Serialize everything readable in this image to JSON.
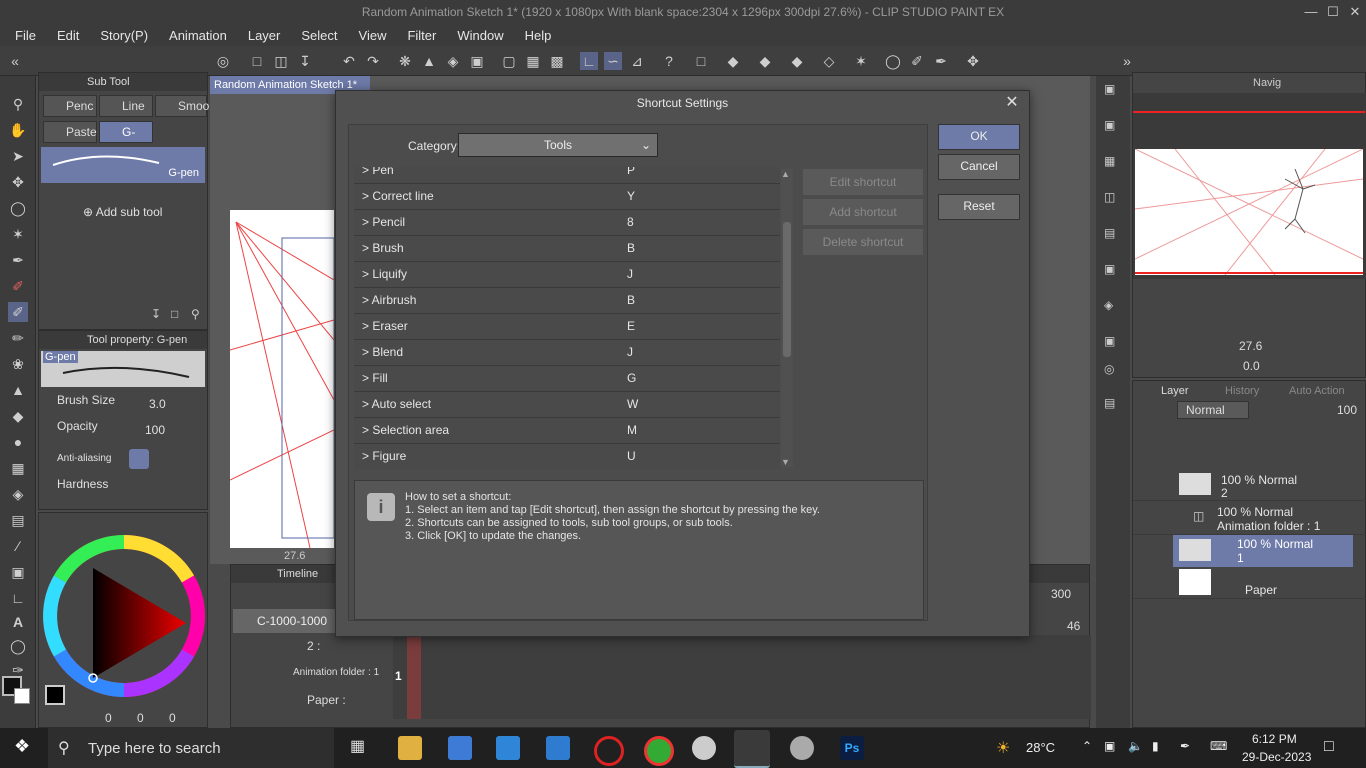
{
  "window": {
    "title": "Random Animation Sketch 1* (1920 x 1080px With blank space:2304 x 1296px 300dpi 27.6%) - CLIP STUDIO PAINT EX"
  },
  "menu": [
    "File",
    "Edit",
    "Story(P)",
    "Animation",
    "Layer",
    "Select",
    "View",
    "Filter",
    "Window",
    "Help"
  ],
  "subtool": {
    "header": "Sub Tool",
    "tabs": [
      "Penc",
      "Line",
      "Smoo",
      "Paste",
      "G-pen"
    ],
    "preview_label": "G-pen",
    "add": "Add sub tool"
  },
  "tool_property": {
    "header": "Tool property: G-pen",
    "preview_label": "G-pen",
    "brush_size_label": "Brush Size",
    "brush_size": "3.0",
    "opacity_label": "Opacity",
    "opacity": "100",
    "aa_label": "Anti-aliasing",
    "hardness_label": "Hardness"
  },
  "color": {
    "r": "0",
    "g": "0",
    "b": "0"
  },
  "canvas": {
    "tab": "Random Animation Sketch 1*",
    "zoom": "27.6"
  },
  "timeline": {
    "header": "Timeline",
    "track_name": "C-1000-1000",
    "frame_end": "300",
    "frame_mark": "46",
    "rows": [
      "2 :",
      "Animation folder : 1",
      "Paper :"
    ],
    "cell": "1"
  },
  "dialog": {
    "title": "Shortcut Settings",
    "category_label": "Category:",
    "category_value": "Tools",
    "items": [
      {
        "name": "> Pen",
        "key": "P"
      },
      {
        "name": "> Correct line",
        "key": "Y"
      },
      {
        "name": "> Pencil",
        "key": "8"
      },
      {
        "name": "> Brush",
        "key": "B"
      },
      {
        "name": "> Liquify",
        "key": "J"
      },
      {
        "name": "> Airbrush",
        "key": "B"
      },
      {
        "name": "> Eraser",
        "key": "E"
      },
      {
        "name": "> Blend",
        "key": "J"
      },
      {
        "name": "> Fill",
        "key": "G"
      },
      {
        "name": "> Auto select",
        "key": "W"
      },
      {
        "name": "> Selection area",
        "key": "M"
      },
      {
        "name": "> Figure",
        "key": "U"
      }
    ],
    "side_buttons": [
      "Edit shortcut",
      "Add shortcut",
      "Delete shortcut"
    ],
    "ok": "OK",
    "cancel": "Cancel",
    "reset": "Reset",
    "info": [
      "How to set a shortcut:",
      "1. Select an item and tap [Edit shortcut], then assign the shortcut by pressing the key.",
      "2. Shortcuts can be assigned to tools, sub tool groups, or sub tools.",
      "3. Click [OK] to update the changes."
    ]
  },
  "navigator": {
    "tab": "Navig",
    "zoom": "27.6",
    "rotation": "0.0"
  },
  "layers": {
    "tab": "Layer",
    "tab2": "History",
    "tab3": "Auto Action",
    "blend": "Normal",
    "opacity": "100",
    "items": [
      {
        "mode": "100 % Normal",
        "name": "2"
      },
      {
        "mode": "100 % Normal",
        "name": "Animation folder : 1"
      },
      {
        "mode": "100 % Normal",
        "name": "1"
      },
      {
        "mode": "",
        "name": "Paper"
      }
    ]
  },
  "taskbar": {
    "search_placeholder": "Type here to search",
    "temp": "28°C",
    "time": "6:12 PM",
    "date": "29-Dec-2023"
  }
}
